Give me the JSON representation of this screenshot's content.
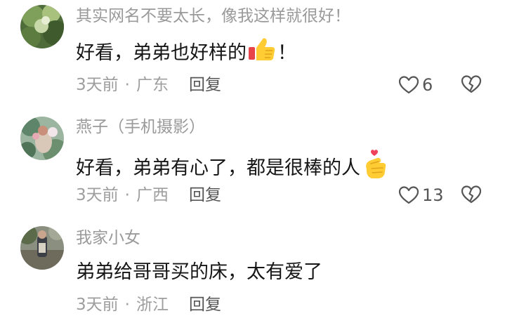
{
  "comments": [
    {
      "username": "其实网名不要太长，像我这样就很好！",
      "text": "好看，弟弟也好样的",
      "emoji": "thumbs-up",
      "text_after": "！",
      "time": "3天前",
      "separator": "·",
      "location": "广东",
      "reply_label": "回复",
      "likes": "6"
    },
    {
      "username": "燕子（手机摄影）",
      "text": "好看，弟弟有心了，都是很棒的人",
      "emoji": "finger-heart",
      "time": "3天前",
      "separator": "·",
      "location": "广西",
      "reply_label": "回复",
      "likes": "13"
    },
    {
      "username": "我家小女",
      "text": "弟弟给哥哥买的床，太有爱了",
      "time": "3天前",
      "separator": "·",
      "location": "浙江",
      "reply_label": "回复"
    }
  ],
  "icons": {
    "like": "heart-outline-icon",
    "dislike": "broken-heart-icon"
  },
  "colors": {
    "username": "#9a9a9a",
    "text": "#161616",
    "meta": "#9e9e9e",
    "reply": "#565656",
    "icon": "#555555"
  }
}
